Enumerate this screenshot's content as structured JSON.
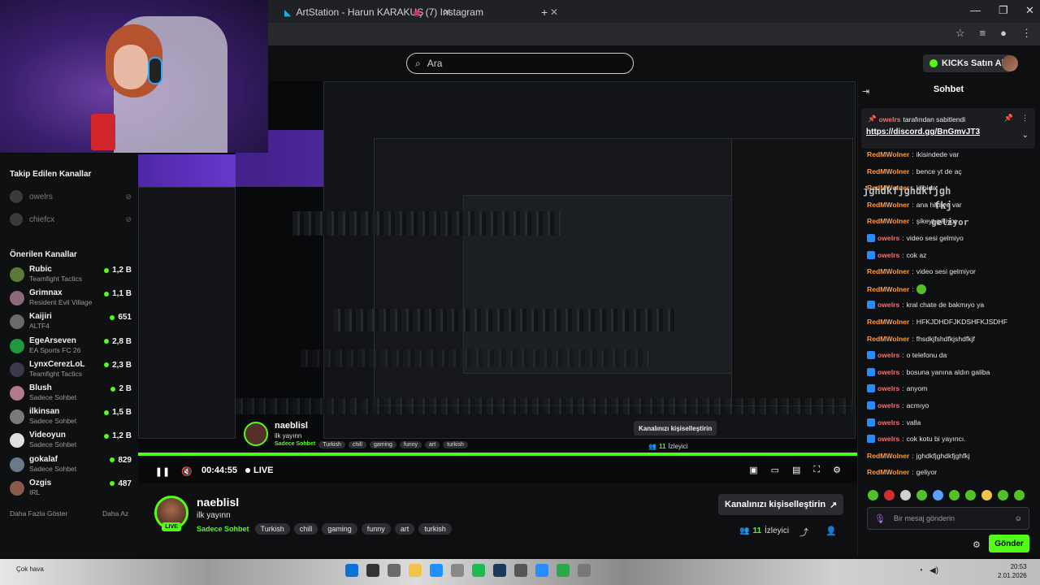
{
  "browser": {
    "tabs": [
      {
        "label": "ArtStation - Harun KARAKUŞ",
        "icon": "artstation-icon"
      },
      {
        "label": "(7) Instagram",
        "icon": "instagram-icon"
      }
    ]
  },
  "header": {
    "search_placeholder": "Ara",
    "kicks_label": "KICKs Satın Al"
  },
  "sidebar": {
    "followed_title": "Takip Edilen Kanallar",
    "followed": [
      {
        "name": "owelrs"
      },
      {
        "name": "chiefcx"
      }
    ],
    "recommended_title": "Önerilen Kanallar",
    "recommended": [
      {
        "name": "Rubic",
        "category": "Teamfight Tactics",
        "viewers": "1,2 B",
        "color": "#5a7a3a"
      },
      {
        "name": "Grimnax",
        "category": "Resident Evil Village",
        "viewers": "1,1 B",
        "color": "#8a6a7a"
      },
      {
        "name": "Kaijiri",
        "category": "ALTF4",
        "viewers": "651",
        "color": "#6a6a6a"
      },
      {
        "name": "EgeArseven",
        "category": "EA Sports FC 26",
        "viewers": "2,8 B",
        "color": "#1e9a3a"
      },
      {
        "name": "LynxCerezLoL",
        "category": "Teamfight Tactics",
        "viewers": "2,3 B",
        "color": "#3a3a4a"
      },
      {
        "name": "Blush",
        "category": "Sadece Sohbet",
        "viewers": "2 B",
        "color": "#b07a8a"
      },
      {
        "name": "ilkinsan",
        "category": "Sadece Sohbet",
        "viewers": "1,5 B",
        "color": "#7a7a7a"
      },
      {
        "name": "Videoyun",
        "category": "Sadece Sohbet",
        "viewers": "1,2 B",
        "color": "#e0e0e0"
      },
      {
        "name": "gokalaf",
        "category": "Sadece Sohbet",
        "viewers": "829",
        "color": "#6a7a8a"
      },
      {
        "name": "Ozgis",
        "category": "IRL",
        "viewers": "487",
        "color": "#8a5a4a"
      }
    ],
    "show_more": "Daha Fazla Göster",
    "show_less": "Daha Az"
  },
  "player": {
    "time": "00:44:55",
    "live": "LIVE",
    "progress": 1.0,
    "inner_streamer": "naeblisl",
    "inner_title": "ilk yayınn",
    "inner_personalize": "Kanalınızı kişiselleştirin",
    "inner_viewers_count": "11",
    "inner_viewers_label": "İzleyici"
  },
  "stream": {
    "streamer": "naeblisl",
    "title": "ilk yayınn",
    "live_badge": "LIVE",
    "category": "Sadece Sohbet",
    "tags": [
      "Turkish",
      "chill",
      "gaming",
      "funny",
      "art",
      "turkish"
    ],
    "personalize": "Kanalınızı kişiselleştirin",
    "viewers_count": "11",
    "viewers_label": "İzleyici"
  },
  "chat": {
    "title": "Sohbet",
    "pinned": {
      "user": "owelrs",
      "by_text": "tarafından sabitlendi",
      "link": "https://discord.gg/BnGmvJT3"
    },
    "messages": [
      {
        "user": "RedMWolner",
        "text": "ikisindede var",
        "color": "#ff9a3c",
        "badge": false,
        "emote": false
      },
      {
        "user": "RedMWolner",
        "text": "bence yt de aç",
        "color": "#ff9a3c",
        "badge": false,
        "emote": false
      },
      {
        "user": "RedMWolner",
        "text": "klibidə",
        "color": "#ff9a3c",
        "badge": false,
        "emote": false
      },
      {
        "user": "RedMWolner",
        "text": "ana hikaye var",
        "color": "#ff9a3c",
        "badge": false,
        "emote": false
      },
      {
        "user": "RedMWolner",
        "text": "şikeyt geliyor",
        "color": "#ff9a3c",
        "badge": false,
        "emote": false
      },
      {
        "user": "owelrs",
        "text": "video sesi gelmiyo",
        "color": "#ff6b6b",
        "badge": true,
        "emote": false
      },
      {
        "user": "owelrs",
        "text": "cok az",
        "color": "#ff6b6b",
        "badge": true,
        "emote": false
      },
      {
        "user": "RedMWolner",
        "text": "video sesi gelmiyor",
        "color": "#ff9a3c",
        "badge": false,
        "emote": false
      },
      {
        "user": "RedMWolner",
        "text": "",
        "color": "#ff9a3c",
        "badge": false,
        "emote": true
      },
      {
        "user": "owelrs",
        "text": "kral chate de bakmıyo ya",
        "color": "#ff6b6b",
        "badge": true,
        "emote": false
      },
      {
        "user": "RedMWolner",
        "text": "HFKJDHDFJKDSHFKJSDHF",
        "color": "#ff9a3c",
        "badge": false,
        "emote": false
      },
      {
        "user": "RedMWolner",
        "text": "fhsdkjfshdfkjshdfkjf",
        "color": "#ff9a3c",
        "badge": false,
        "emote": false
      },
      {
        "user": "owelrs",
        "text": "o telefonu da",
        "color": "#ff6b6b",
        "badge": true,
        "emote": false
      },
      {
        "user": "owelrs",
        "text": "bosuna yanına aldın galiba",
        "color": "#ff6b6b",
        "badge": true,
        "emote": false
      },
      {
        "user": "owelrs",
        "text": "anyom",
        "color": "#ff6b6b",
        "badge": true,
        "emote": false
      },
      {
        "user": "owelrs",
        "text": "acmıyo",
        "color": "#ff6b6b",
        "badge": true,
        "emote": false
      },
      {
        "user": "owelrs",
        "text": "valla",
        "color": "#ff6b6b",
        "badge": true,
        "emote": false
      },
      {
        "user": "owelrs",
        "text": "cok kotu bi yayıncı.",
        "color": "#ff6b6b",
        "badge": true,
        "emote": false
      },
      {
        "user": "RedMWolner",
        "text": "jghdkfjghdkfjghfkj",
        "color": "#ff9a3c",
        "badge": false,
        "emote": false
      },
      {
        "user": "RedMWolner",
        "text": "geliyor",
        "color": "#ff9a3c",
        "badge": false,
        "emote": false
      }
    ],
    "overlay_text_1": "jghdkfjghdkfjgh",
    "overlay_text_2": "fkj",
    "overlay_text_3": "geliyor",
    "input_placeholder": "Bir mesaj gönderin",
    "send_label": "Gönder"
  },
  "taskbar": {
    "weather": "Çok hava",
    "time": "20:53",
    "date": "2.01.2026"
  },
  "colors": {
    "accent": "#53fc18",
    "background": "#0e0f11"
  }
}
